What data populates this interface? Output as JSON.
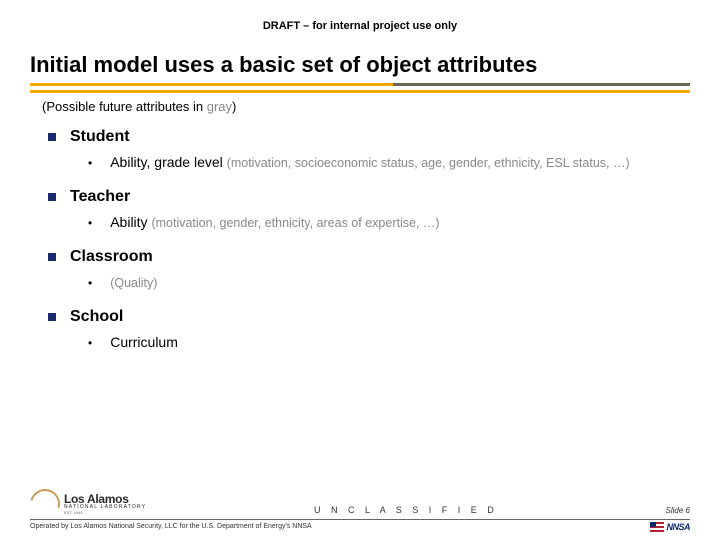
{
  "header": {
    "draft": "DRAFT – for internal project use only"
  },
  "title": "Initial model uses a basic set of object attributes",
  "subtitle": {
    "prefix": "(Possible future attributes in ",
    "gray_word": "gray",
    "suffix": ")"
  },
  "items": [
    {
      "label": "Student",
      "sub_main": "Ability, grade level ",
      "sub_gray": "(motivation, socioeconomic status, age, gender, ethnicity, ESL status, …)"
    },
    {
      "label": "Teacher",
      "sub_main": "Ability ",
      "sub_gray": "(motivation, gender, ethnicity, areas of expertise, …)"
    },
    {
      "label": "Classroom",
      "sub_main": "",
      "sub_gray": "(Quality)"
    },
    {
      "label": "School",
      "sub_main": "Curriculum",
      "sub_gray": ""
    }
  ],
  "footer": {
    "lanl_main": "Los Alamos",
    "lanl_sub": "NATIONAL LABORATORY",
    "lanl_est": "EST. 1943",
    "classification": "U N C L A S S I F I E D",
    "slide_num": "Slide 6",
    "operated": "Operated by Los Alamos National Security, LLC for the U.S. Department of Energy's NNSA",
    "nnsa": "NNSA"
  }
}
